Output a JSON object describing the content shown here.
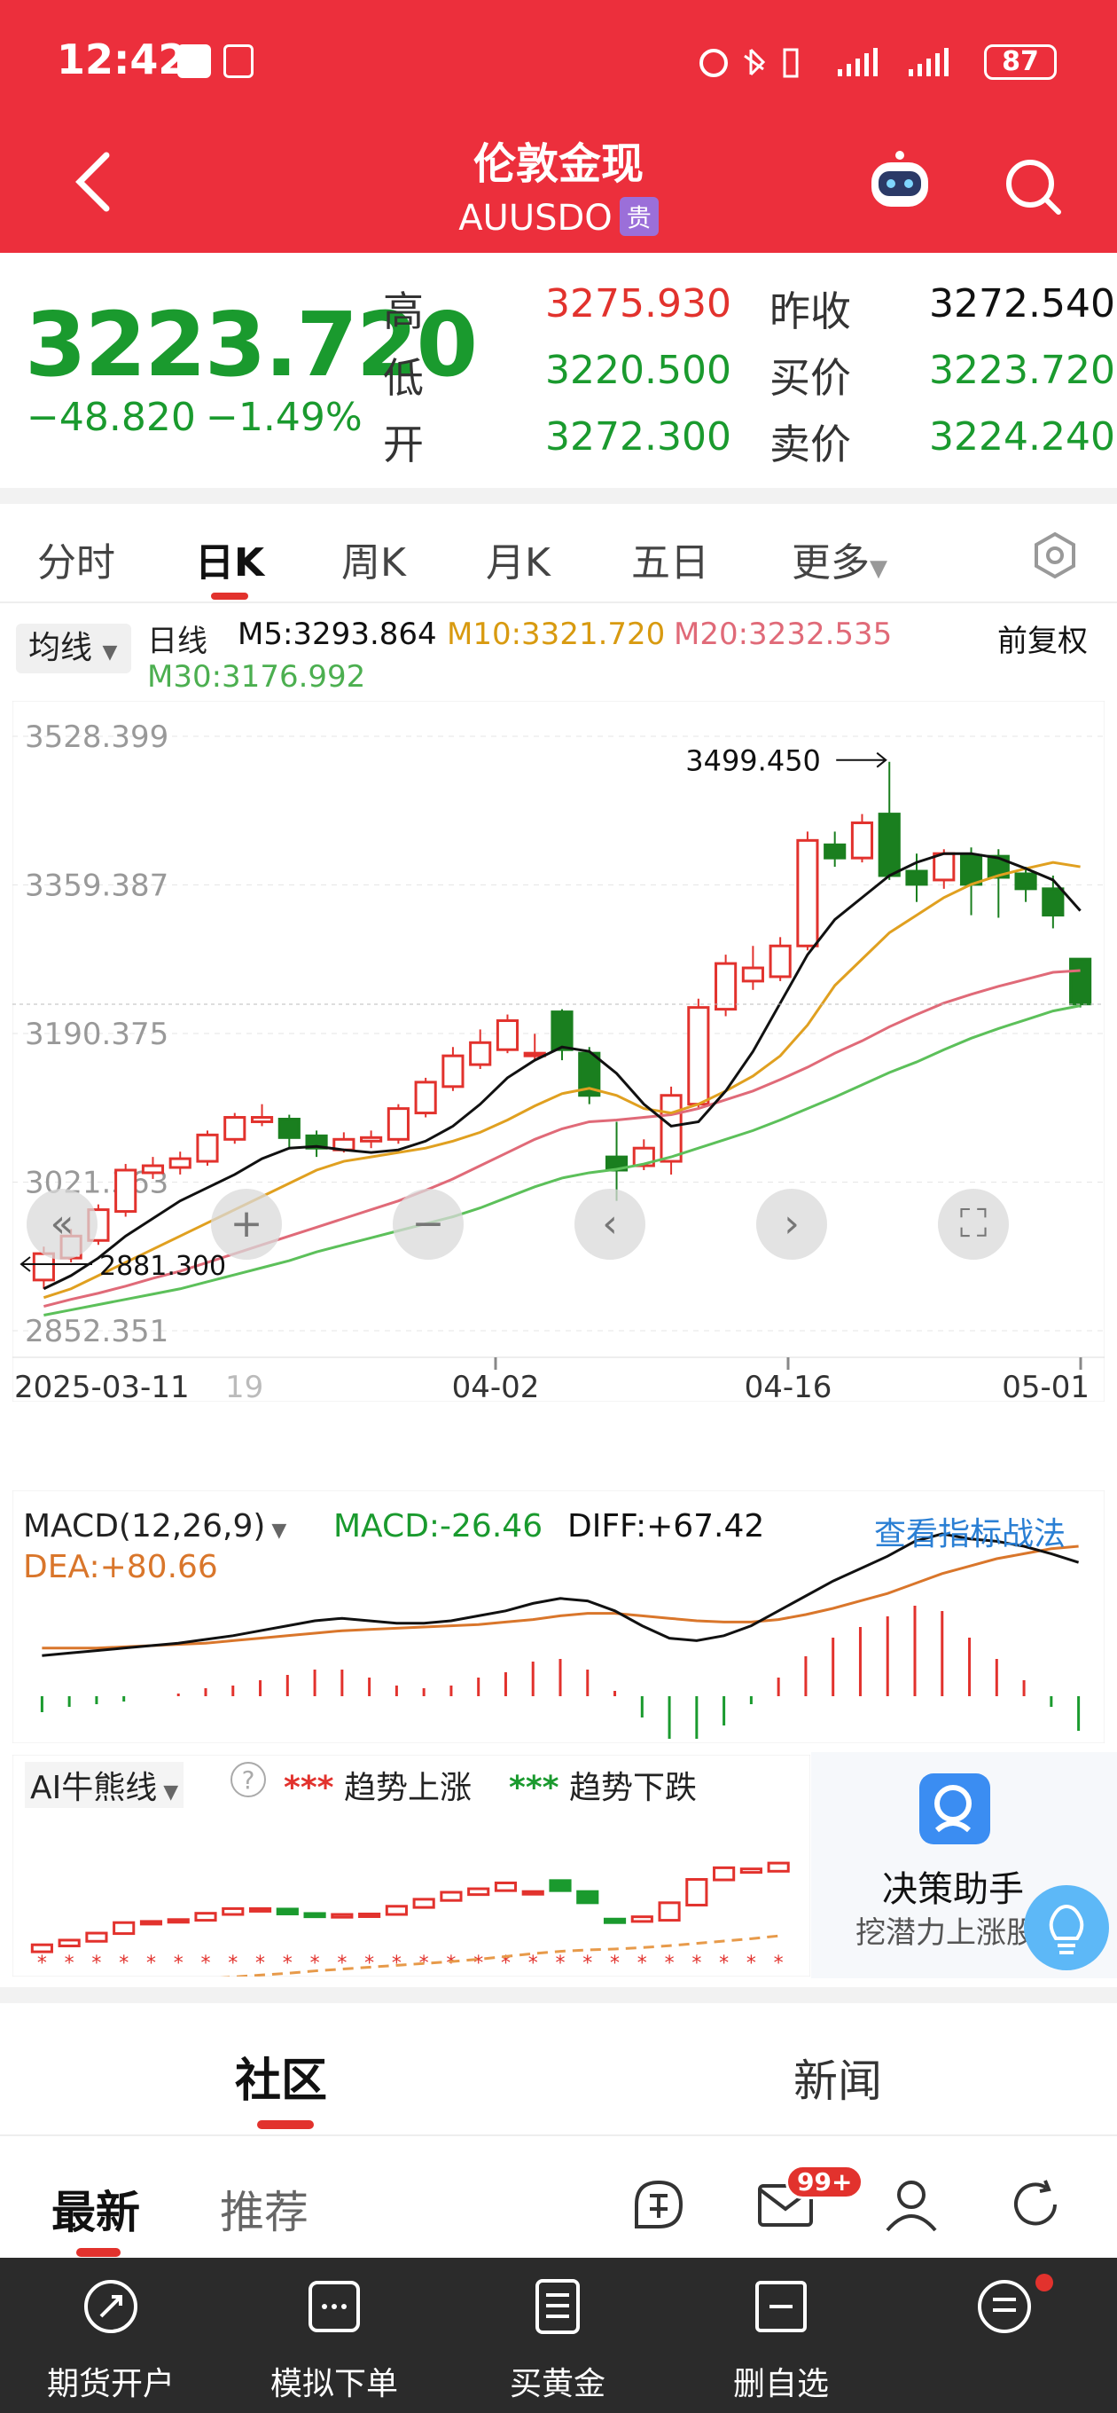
{
  "status": {
    "time": "12:42",
    "battery": "87"
  },
  "header": {
    "title": "伦敦金现",
    "symbol": "AUUSDO",
    "tag": "贵"
  },
  "quote": {
    "price": "3223.720",
    "change": "−48.820",
    "change_pct": "−1.49%",
    "rows": [
      {
        "l1": "高",
        "v1": "3275.930",
        "c1": "red",
        "l2": "昨收",
        "v2": "3272.540",
        "c2": "black"
      },
      {
        "l1": "低",
        "v1": "3220.500",
        "c1": "green",
        "l2": "买价",
        "v2": "3223.720",
        "c2": "green"
      },
      {
        "l1": "开",
        "v1": "3272.300",
        "c1": "green",
        "l2": "卖价",
        "v2": "3224.240",
        "c2": "green"
      }
    ]
  },
  "tabs": [
    "分时",
    "日K",
    "周K",
    "月K",
    "五日",
    "更多"
  ],
  "ma": {
    "selector": "均线",
    "line_type": "日线",
    "m5": "M5:3293.864",
    "m10": "M10:3321.720",
    "m20": "M20:3232.535",
    "m30": "M30:3176.992",
    "adjust": "前复权",
    "colors": {
      "m5": "#111111",
      "m10": "#e0a020",
      "m20": "#e06a78",
      "m30": "#5cc05a"
    }
  },
  "chart_data": {
    "type": "candlestick",
    "y_ticks": [
      "3528.399",
      "3359.387",
      "3190.375",
      "3021.363",
      "2852.351"
    ],
    "ylim": [
      2852.351,
      3528.399
    ],
    "x_labels": [
      "2025-03-11",
      "19",
      "04-02",
      "04-16",
      "05-01"
    ],
    "high_label": "3499.450",
    "low_label": "2881.300",
    "candles": [
      [
        2910,
        2940,
        2900,
        2948
      ],
      [
        2935,
        2960,
        2930,
        2968
      ],
      [
        2955,
        2990,
        2950,
        2996
      ],
      [
        2988,
        3035,
        2982,
        3042
      ],
      [
        3032,
        3040,
        3025,
        3050
      ],
      [
        3038,
        3048,
        3030,
        3056
      ],
      [
        3045,
        3075,
        3040,
        3080
      ],
      [
        3070,
        3095,
        3065,
        3100
      ],
      [
        3090,
        3095,
        3085,
        3110
      ],
      [
        3093,
        3072,
        3060,
        3098
      ],
      [
        3074,
        3060,
        3050,
        3080
      ],
      [
        3058,
        3070,
        3055,
        3078
      ],
      [
        3068,
        3072,
        3060,
        3080
      ],
      [
        3070,
        3105,
        3065,
        3110
      ],
      [
        3100,
        3135,
        3095,
        3140
      ],
      [
        3130,
        3165,
        3125,
        3175
      ],
      [
        3155,
        3180,
        3150,
        3195
      ],
      [
        3172,
        3205,
        3168,
        3212
      ],
      [
        3168,
        3168,
        3160,
        3190
      ],
      [
        3215,
        3172,
        3160,
        3218
      ],
      [
        3168,
        3120,
        3110,
        3175
      ],
      [
        3050,
        3035,
        3000,
        3090
      ],
      [
        3040,
        3060,
        3035,
        3070
      ],
      [
        3045,
        3120,
        3030,
        3130
      ],
      [
        3110,
        3220,
        3105,
        3230
      ],
      [
        3218,
        3270,
        3210,
        3280
      ],
      [
        3250,
        3265,
        3240,
        3290
      ],
      [
        3255,
        3290,
        3250,
        3300
      ],
      [
        3290,
        3410,
        3285,
        3420
      ],
      [
        3405,
        3390,
        3380,
        3420
      ],
      [
        3390,
        3430,
        3385,
        3440
      ],
      [
        3440,
        3370,
        3365,
        3499.45
      ],
      [
        3375,
        3360,
        3340,
        3395
      ],
      [
        3365,
        3395,
        3355,
        3400
      ],
      [
        3393,
        3360,
        3325,
        3402
      ],
      [
        3392,
        3368,
        3322,
        3400
      ],
      [
        3372,
        3355,
        3340,
        3380
      ],
      [
        3355,
        3325,
        3310,
        3370
      ],
      [
        3275,
        3224,
        3220,
        3276
      ]
    ],
    "m5": [
      2900,
      2915,
      2935,
      2960,
      2980,
      3000,
      3015,
      3030,
      3048,
      3060,
      3062,
      3058,
      3055,
      3058,
      3068,
      3085,
      3110,
      3140,
      3160,
      3175,
      3170,
      3145,
      3110,
      3085,
      3090,
      3125,
      3170,
      3225,
      3280,
      3320,
      3345,
      3370,
      3385,
      3395,
      3395,
      3390,
      3378,
      3365,
      3330
    ],
    "m10": [
      2890,
      2900,
      2915,
      2930,
      2945,
      2960,
      2975,
      2990,
      3005,
      3020,
      3035,
      3045,
      3050,
      3055,
      3060,
      3068,
      3078,
      3092,
      3108,
      3122,
      3128,
      3120,
      3105,
      3100,
      3110,
      3125,
      3142,
      3165,
      3200,
      3245,
      3275,
      3305,
      3325,
      3345,
      3360,
      3370,
      3378,
      3385,
      3380
    ],
    "m20": [
      2880,
      2888,
      2895,
      2903,
      2912,
      2920,
      2930,
      2940,
      2950,
      2960,
      2970,
      2980,
      2990,
      3000,
      3012,
      3025,
      3040,
      3055,
      3070,
      3082,
      3090,
      3092,
      3095,
      3098,
      3105,
      3115,
      3125,
      3138,
      3152,
      3168,
      3182,
      3198,
      3212,
      3225,
      3235,
      3244,
      3252,
      3260,
      3262
    ],
    "m30": [
      2870,
      2876,
      2882,
      2888,
      2894,
      2900,
      2908,
      2916,
      2924,
      2932,
      2942,
      2950,
      2958,
      2966,
      2974,
      2982,
      2992,
      3004,
      3016,
      3026,
      3032,
      3036,
      3042,
      3050,
      3060,
      3070,
      3080,
      3092,
      3105,
      3118,
      3132,
      3146,
      3158,
      3172,
      3185,
      3196,
      3206,
      3216,
      3222
    ]
  },
  "chart_controls": [
    "fast-back",
    "zoom-in",
    "zoom-out",
    "prev",
    "next",
    "fullscreen"
  ],
  "macd": {
    "label": "MACD(12,26,9)",
    "macd": "MACD:-26.46",
    "diff": "DIFF:+67.42",
    "dea": "DEA:+80.66",
    "link": "查看指标战法",
    "diff_line": [
      -8,
      -6,
      -4,
      -2,
      0,
      2,
      5,
      8,
      12,
      16,
      20,
      22,
      20,
      18,
      18,
      20,
      24,
      28,
      34,
      38,
      36,
      28,
      16,
      6,
      4,
      8,
      16,
      28,
      40,
      52,
      62,
      72,
      84,
      90,
      86,
      84,
      80,
      74,
      67
    ],
    "dea_line": [
      -2,
      -2,
      -2,
      -1,
      0,
      1,
      2,
      4,
      6,
      8,
      10,
      12,
      13,
      14,
      15,
      16,
      17,
      19,
      21,
      24,
      26,
      26,
      24,
      22,
      20,
      19,
      19,
      21,
      25,
      30,
      36,
      42,
      50,
      58,
      64,
      70,
      74,
      78,
      80
    ],
    "hist": [
      -12,
      -8,
      -6,
      -4,
      0,
      2,
      6,
      8,
      12,
      16,
      20,
      20,
      14,
      8,
      6,
      8,
      14,
      18,
      26,
      28,
      20,
      4,
      -16,
      -32,
      -32,
      -22,
      -6,
      14,
      30,
      44,
      52,
      60,
      68,
      64,
      44,
      28,
      12,
      -8,
      -26
    ]
  },
  "ai": {
    "label": "AI牛熊线",
    "up": "趋势上涨",
    "down": "趋势下跌",
    "decision_title": "决策助手",
    "decision_sub": "挖潜力上涨股"
  },
  "community": {
    "tabs": [
      "社区",
      "新闻"
    ],
    "sub_tabs": [
      "最新",
      "推荐"
    ],
    "badge": "99+"
  },
  "bottom_nav": [
    "期货开户",
    "模拟下单",
    "买黄金",
    "删自选",
    ""
  ]
}
